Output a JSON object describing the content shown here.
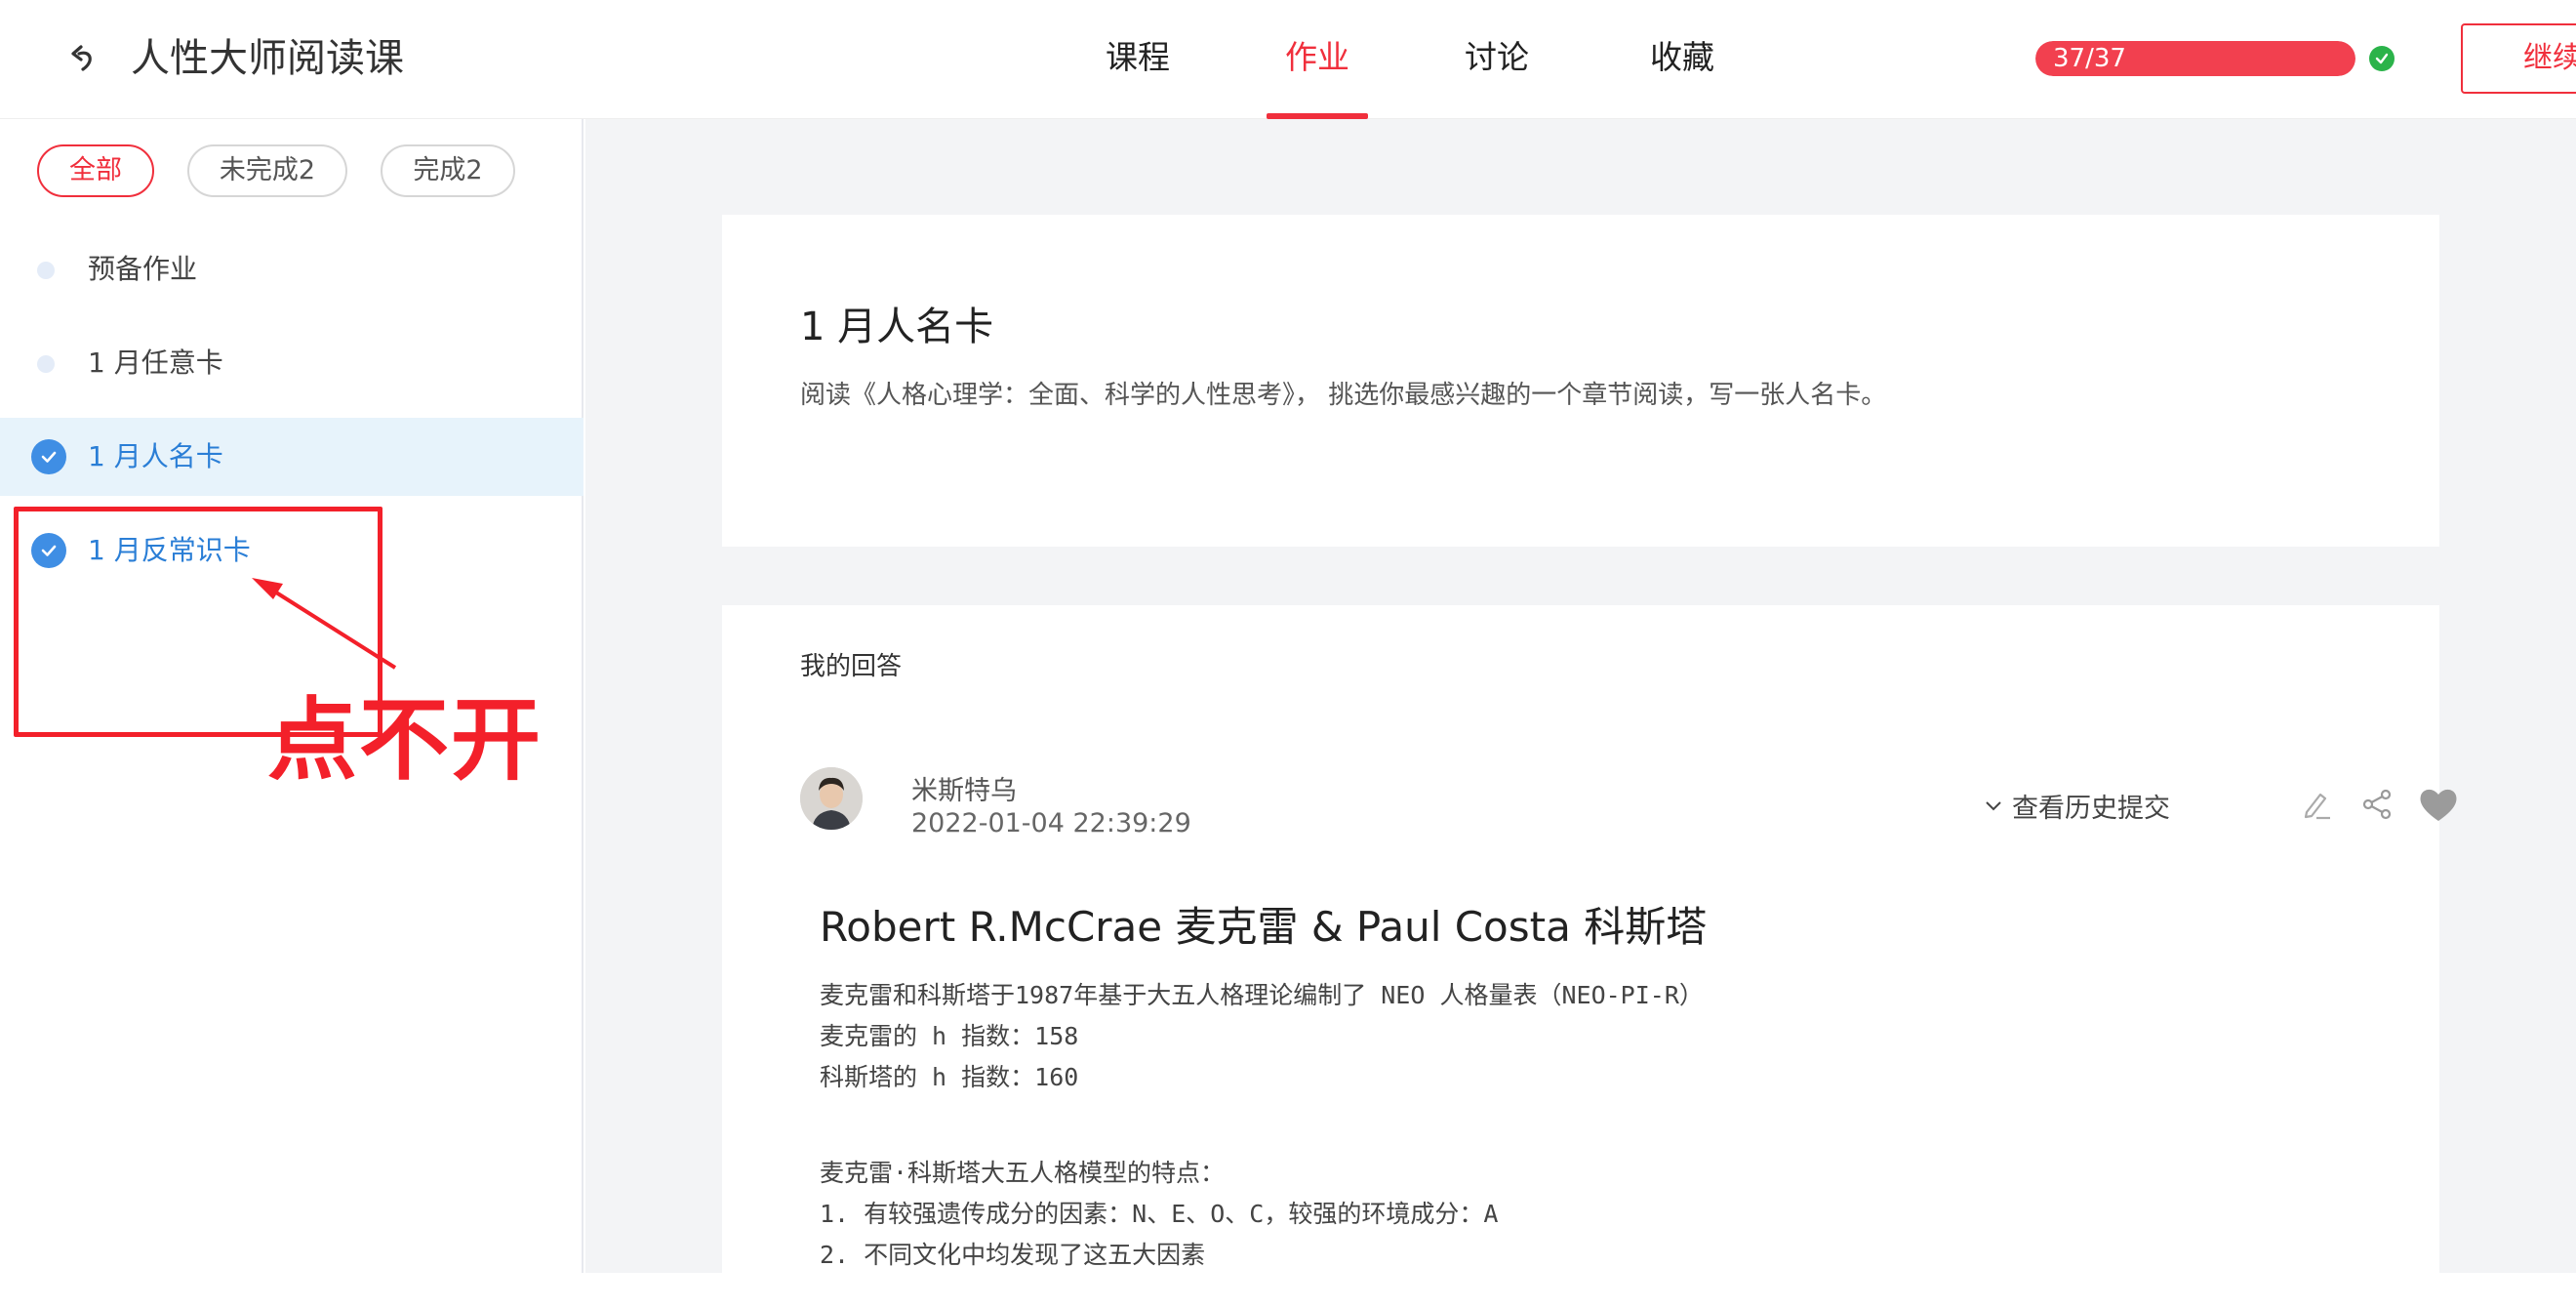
{
  "header": {
    "back_icon": "back-arrow-icon",
    "title": "人性大师阅读课",
    "tabs": [
      {
        "label": "课程",
        "active": false
      },
      {
        "label": "作业",
        "active": true
      },
      {
        "label": "讨论",
        "active": false
      },
      {
        "label": "收藏",
        "active": false
      }
    ],
    "progress": {
      "text": "37/37",
      "value": 1.0,
      "status_icon": "check-circle-icon"
    },
    "continue_label": "继续",
    "accent_color": "#f02f3c"
  },
  "sidebar": {
    "filters": [
      {
        "label": "全部",
        "active": true
      },
      {
        "label": "未完成2",
        "active": false
      },
      {
        "label": "完成2",
        "active": false
      }
    ],
    "items": [
      {
        "label": "预备作业",
        "done": false,
        "selected": false
      },
      {
        "label": "1 月任意卡",
        "done": false,
        "selected": false
      },
      {
        "label": "1 月人名卡",
        "done": true,
        "selected": true
      },
      {
        "label": "1 月反常识卡",
        "done": true,
        "selected": false
      }
    ],
    "annotation": {
      "text": "点不开",
      "color": "#f3202a"
    }
  },
  "assignment": {
    "title": "1 月人名卡",
    "description": "阅读《人格心理学：全面、科学的人性思考》， 挑选你最感兴趣的一个章节阅读，写一张人名卡。"
  },
  "my_answer": {
    "heading": "我的回答",
    "author": {
      "name": "米斯特乌",
      "time": "2022-01-04 22:39:29",
      "avatar_icon": "user-avatar"
    },
    "history_label": "查看历史提交",
    "action_icons": [
      "edit-icon",
      "share-icon",
      "heart-icon"
    ],
    "title": "Robert R.McCrae 麦克雷 & Paul Costa 科斯塔",
    "lines": [
      "麦克雷和科斯塔于1987年基于大五人格理论编制了 NEO 人格量表（NEO-PI-R）",
      "麦克雷的 h 指数：158",
      "科斯塔的 h 指数：160",
      "",
      "麦克雷·科斯塔大五人格模型的特点：",
      "1. 有较强遗传成分的因素：N、E、O、C，较强的环境成分：A",
      "2. 不同文化中均发现了这五大因素"
    ]
  }
}
